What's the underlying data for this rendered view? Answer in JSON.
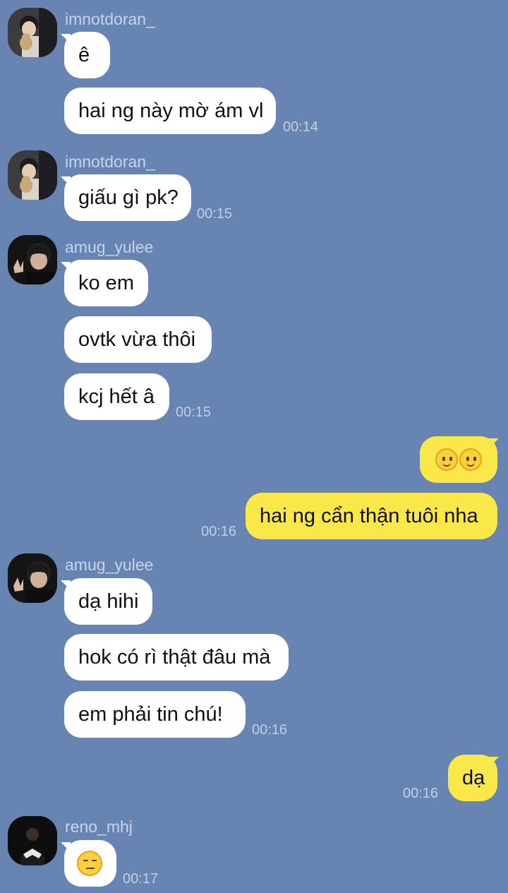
{
  "colors": {
    "background": "#6784b2",
    "incoming_bubble": "#ffffff",
    "outgoing_bubble": "#fae84b",
    "timestamp": "#c3cfe4"
  },
  "messages": {
    "g1": {
      "sender": "imnotdoran_",
      "texts": [
        "ê",
        "hai ng này mờ ám vl"
      ],
      "time": "00:14"
    },
    "g2": {
      "sender": "imnotdoran_",
      "texts": [
        "giấu gì pk?"
      ],
      "time": "00:15"
    },
    "g3": {
      "sender": "amug_yulee",
      "texts": [
        "ko em",
        "ovtk vừa thôi",
        "kcj hết â"
      ],
      "time": "00:15"
    },
    "g4": {
      "emoji": [
        "smiling-face",
        "smiling-face"
      ],
      "texts": [
        "hai ng cẩn thận tuôi nha"
      ],
      "time": "00:16"
    },
    "g5": {
      "sender": "amug_yulee",
      "texts": [
        "dạ hihi",
        "hok có rì thật đâu mà",
        "em phải tin chú!"
      ],
      "time": "00:16"
    },
    "g6": {
      "texts": [
        "dạ"
      ],
      "time": "00:16"
    },
    "g7": {
      "sender": "reno_mhj",
      "emoji": "unamused-face",
      "time": "00:17"
    }
  }
}
